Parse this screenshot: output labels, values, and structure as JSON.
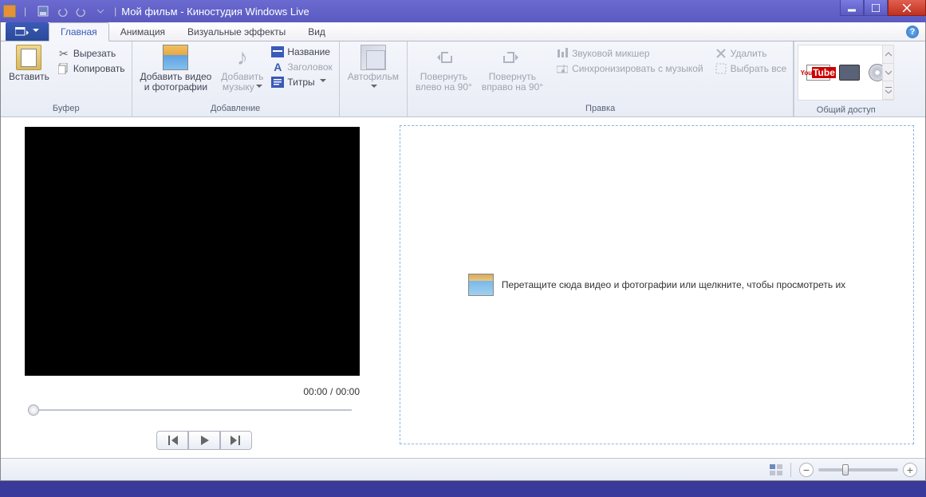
{
  "title": "Мой фильм - Киностудия Windows Live",
  "tabs": {
    "home": "Главная",
    "animation": "Анимация",
    "effects": "Визуальные эффекты",
    "view": "Вид"
  },
  "ribbon": {
    "clipboard": {
      "label": "Буфер",
      "paste": "Вставить",
      "cut": "Вырезать",
      "copy": "Копировать"
    },
    "add": {
      "label": "Добавление",
      "add_video": "Добавить видео\nи фотографии",
      "add_music": "Добавить\nмузыку",
      "title_btn": "Название",
      "caption": "Заголовок",
      "credits": "Титры"
    },
    "autofilm": "Автофильм",
    "edit": {
      "label": "Правка",
      "rotate_left": "Повернуть\nвлево на 90°",
      "rotate_right": "Повернуть\nвправо на 90°",
      "mixer": "Звуковой микшер",
      "sync": "Синхронизировать с музыкой",
      "delete": "Удалить",
      "select_all": "Выбрать все"
    },
    "share": {
      "label": "Общий доступ"
    }
  },
  "preview": {
    "time_current": "00:00",
    "time_total": "00:00",
    "sep": "/"
  },
  "dropzone": "Перетащите сюда видео и фотографии или щелкните, чтобы просмотреть их"
}
